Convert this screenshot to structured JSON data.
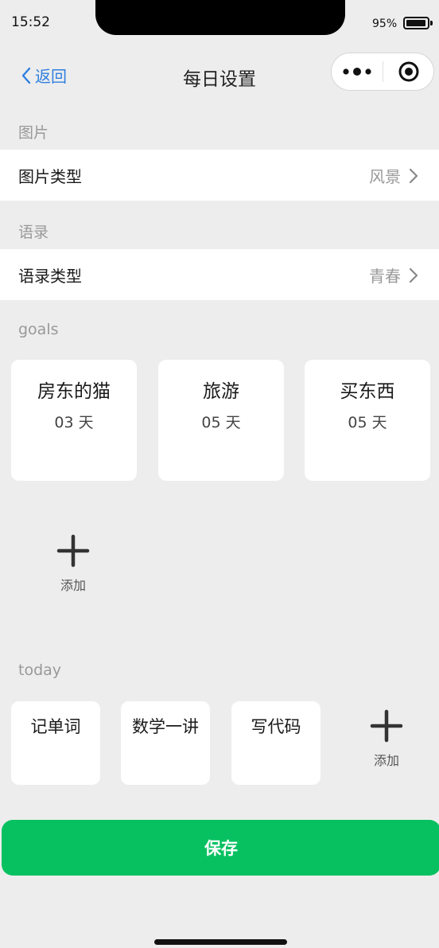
{
  "status_bar": {
    "time": "15:52",
    "battery": "95%",
    "battery_level": 0.95
  },
  "nav": {
    "back_label": "返回",
    "title": "每日设置"
  },
  "sections": {
    "image": "图片",
    "quote": "语录",
    "goals": "goals",
    "today": "today"
  },
  "settings": {
    "image_type": {
      "label": "图片类型",
      "value": "风景"
    },
    "quote_type": {
      "label": "语录类型",
      "value": "青春"
    }
  },
  "goals": [
    {
      "name": "房东的猫",
      "days": "03 天"
    },
    {
      "name": "旅游",
      "days": "05 天"
    },
    {
      "name": "买东西",
      "days": "05 天"
    }
  ],
  "add_label": "添加",
  "today": [
    {
      "name": "记单词"
    },
    {
      "name": "数学一讲"
    },
    {
      "name": "写代码"
    }
  ],
  "save_label": "保存",
  "colors": {
    "accent_green": "#07c160",
    "link_blue": "#2f7fe0",
    "background": "#ededed"
  }
}
